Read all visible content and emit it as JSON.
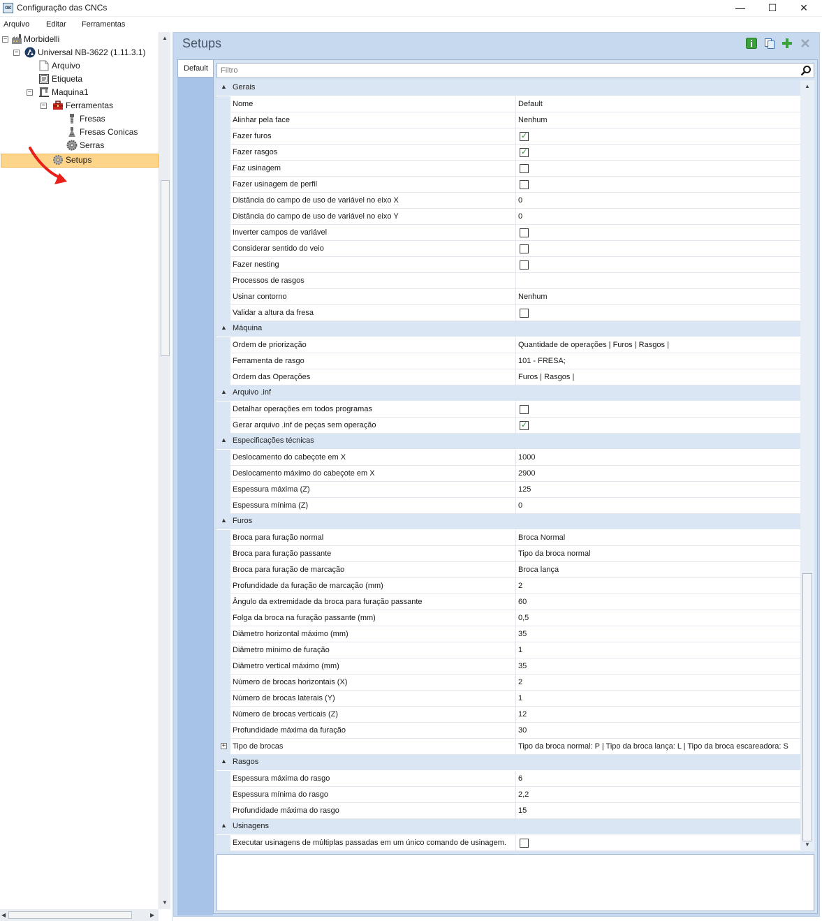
{
  "window": {
    "title": "Configuração das CNCs",
    "app_icon_text": "CNC",
    "controls": {
      "minimize": "—",
      "maximize": "☐",
      "close": "✕"
    }
  },
  "menu": {
    "items": [
      "Arquivo",
      "Editar",
      "Ferramentas"
    ]
  },
  "tree": {
    "nodes": [
      {
        "label": "Morbidelli",
        "icon": "factory-icon",
        "expander": "−"
      },
      {
        "label": "Universal NB-3622 (1.11.3.1)",
        "icon": "machine-logo-icon",
        "expander": "−"
      },
      {
        "label": "Arquivo",
        "icon": "file-icon"
      },
      {
        "label": "Etiqueta",
        "icon": "label-icon"
      },
      {
        "label": "Maquina1",
        "icon": "machine-icon",
        "expander": "−"
      },
      {
        "label": "Ferramentas",
        "icon": "toolbox-icon",
        "expander": "−"
      },
      {
        "label": "Fresas",
        "icon": "mill-bit-icon"
      },
      {
        "label": "Fresas Conicas",
        "icon": "conical-bit-icon"
      },
      {
        "label": "Serras",
        "icon": "saw-gear-icon"
      },
      {
        "label": "Setups",
        "icon": "gear-icon",
        "selected": true
      }
    ]
  },
  "panel": {
    "title": "Setups",
    "tab_label": "Default",
    "filter_placeholder": "Filtro"
  },
  "colors": {
    "selection": "#fcd48a",
    "panel_bg": "#c6d9ef",
    "section_bg": "#dae6f3",
    "check_green": "#2e8b3c",
    "annotation_red": "#e8201a"
  },
  "sections": [
    {
      "title": "Gerais",
      "rows": [
        {
          "name": "Nome",
          "type": "text",
          "value": "Default"
        },
        {
          "name": "Alinhar pela face",
          "type": "text",
          "value": "Nenhum"
        },
        {
          "name": "Fazer furos",
          "type": "check",
          "checked": true
        },
        {
          "name": "Fazer rasgos",
          "type": "check",
          "checked": true
        },
        {
          "name": "Faz usinagem",
          "type": "check",
          "checked": false
        },
        {
          "name": "Fazer usinagem de perfil",
          "type": "check",
          "checked": false
        },
        {
          "name": "Distância do campo de uso de variável no eixo X",
          "type": "text",
          "value": "0"
        },
        {
          "name": "Distância do campo de uso de variável no eixo Y",
          "type": "text",
          "value": "0"
        },
        {
          "name": "Inverter campos de variável",
          "type": "check",
          "checked": false
        },
        {
          "name": "Considerar sentido do veio",
          "type": "check",
          "checked": false
        },
        {
          "name": "Fazer nesting",
          "type": "check",
          "checked": false
        },
        {
          "name": "Processos de rasgos",
          "type": "text",
          "value": ""
        },
        {
          "name": "Usinar contorno",
          "type": "text",
          "value": "Nenhum"
        },
        {
          "name": "Validar a altura da fresa",
          "type": "check",
          "checked": false
        }
      ]
    },
    {
      "title": "Máquina",
      "rows": [
        {
          "name": "Ordem de priorização",
          "type": "text",
          "value": "Quantidade de operações | Furos | Rasgos |"
        },
        {
          "name": "Ferramenta de rasgo",
          "type": "text",
          "value": "101 - FRESA;"
        },
        {
          "name": "Ordem das Operações",
          "type": "text",
          "value": "Furos | Rasgos |"
        }
      ]
    },
    {
      "title": "Arquivo .inf",
      "rows": [
        {
          "name": "Detalhar operações em todos programas",
          "type": "check",
          "checked": false
        },
        {
          "name": "Gerar arquivo .inf de peças sem operação",
          "type": "check",
          "checked": true
        }
      ]
    },
    {
      "title": "Especificações técnicas",
      "rows": [
        {
          "name": "Deslocamento do cabeçote em X",
          "type": "text",
          "value": "1000"
        },
        {
          "name": "Deslocamento máximo do cabeçote em X",
          "type": "text",
          "value": "2900"
        },
        {
          "name": "Espessura máxima (Z)",
          "type": "text",
          "value": "125"
        },
        {
          "name": "Espessura mínima (Z)",
          "type": "text",
          "value": "0"
        }
      ]
    },
    {
      "title": "Furos",
      "rows": [
        {
          "name": "Broca para furação normal",
          "type": "text",
          "value": "Broca Normal"
        },
        {
          "name": "Broca para furação passante",
          "type": "text",
          "value": "Tipo da broca normal"
        },
        {
          "name": "Broca para furação de marcação",
          "type": "text",
          "value": "Broca lança"
        },
        {
          "name": "Profundidade da furação de marcação (mm)",
          "type": "text",
          "value": "2"
        },
        {
          "name": "Ângulo da extremidade da broca para furação passante",
          "type": "text",
          "value": "60"
        },
        {
          "name": "Folga da broca na furação passante (mm)",
          "type": "text",
          "value": "0,5"
        },
        {
          "name": "Diâmetro horizontal máximo (mm)",
          "type": "text",
          "value": "35"
        },
        {
          "name": "Diâmetro mínimo de furação",
          "type": "text",
          "value": "1"
        },
        {
          "name": "Diâmetro vertical máximo (mm)",
          "type": "text",
          "value": "35"
        },
        {
          "name": "Número de brocas horizontais (X)",
          "type": "text",
          "value": "2"
        },
        {
          "name": "Número de brocas laterais (Y)",
          "type": "text",
          "value": "1"
        },
        {
          "name": "Número de brocas verticais (Z)",
          "type": "text",
          "value": "12"
        },
        {
          "name": "Profundidade máxima da furação",
          "type": "text",
          "value": "30"
        },
        {
          "name": "Tipo de brocas",
          "type": "text",
          "expandable": true,
          "value": "Tipo da broca normal: P  |  Tipo da broca lança: L  |  Tipo da broca escareadora: S"
        }
      ]
    },
    {
      "title": "Rasgos",
      "rows": [
        {
          "name": "Espessura máxima do rasgo",
          "type": "text",
          "value": "6"
        },
        {
          "name": "Espessura mínima do rasgo",
          "type": "text",
          "value": "2,2"
        },
        {
          "name": "Profundidade máxima do rasgo",
          "type": "text",
          "value": "15"
        }
      ]
    },
    {
      "title": "Usinagens",
      "rows": [
        {
          "name": "Executar usinagens de múltiplas passadas em um único comando de usinagem.",
          "type": "check",
          "checked": false
        }
      ]
    }
  ]
}
